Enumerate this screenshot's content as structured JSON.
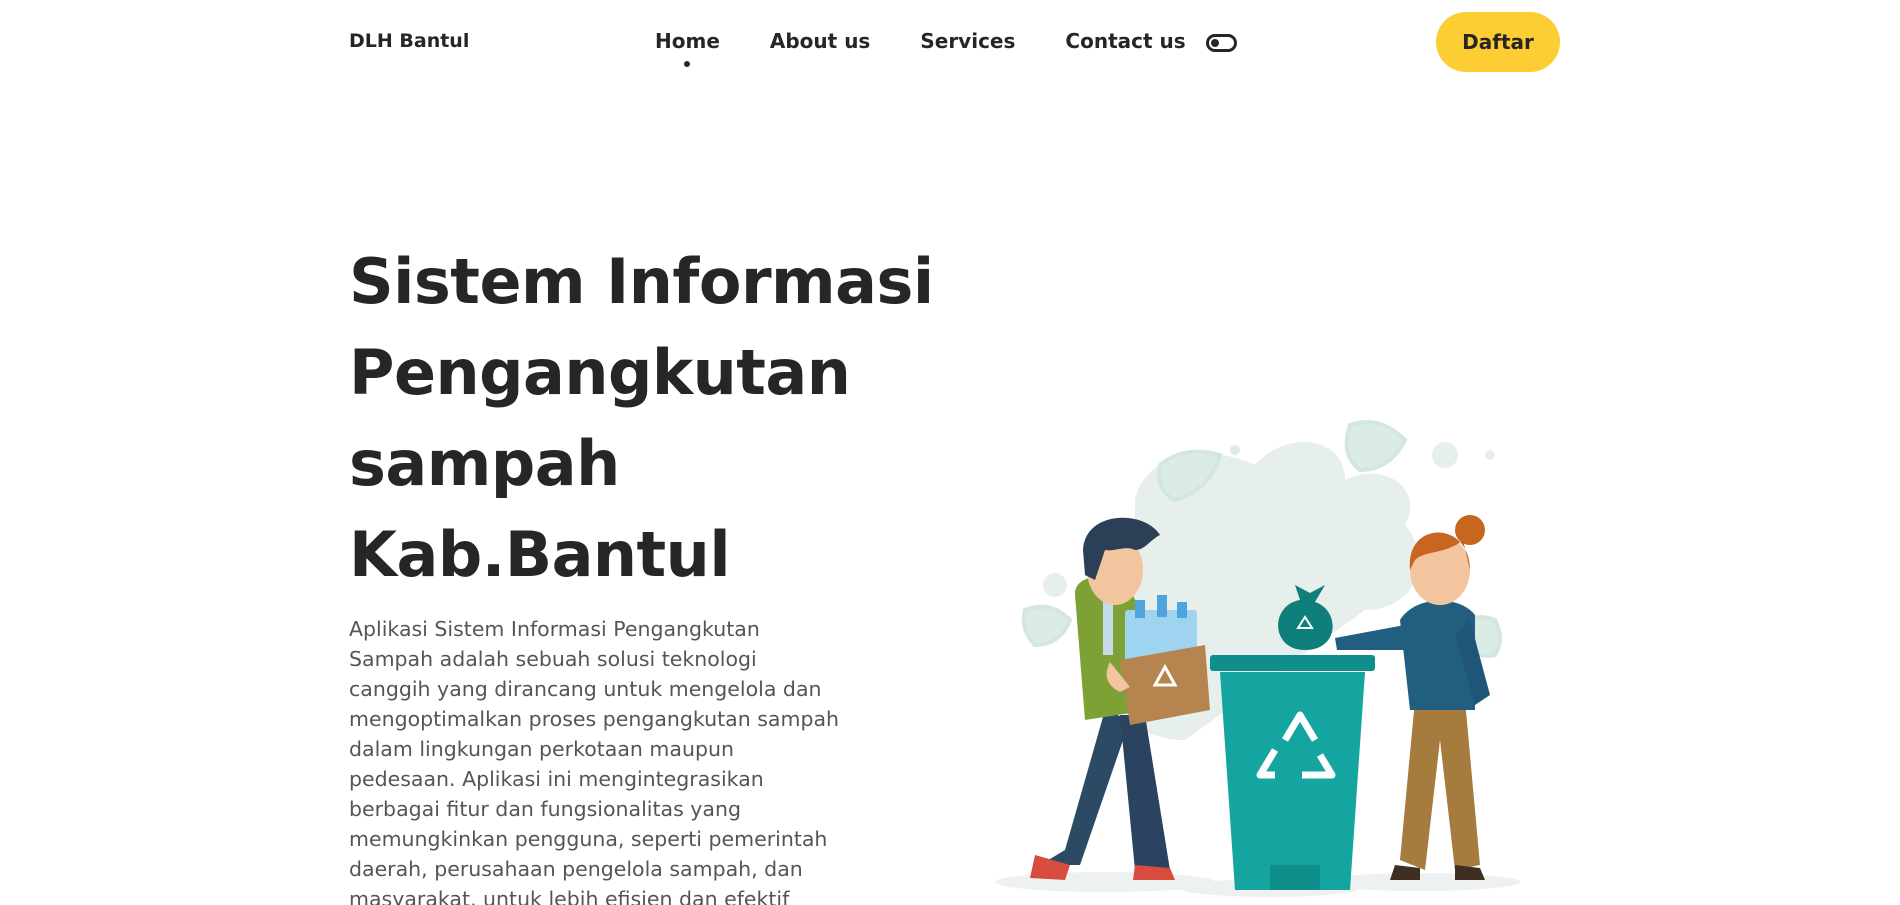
{
  "nav": {
    "brand": "DLH Bantul",
    "items": [
      {
        "label": "Home",
        "active": true
      },
      {
        "label": "About us",
        "active": false
      },
      {
        "label": "Services",
        "active": false
      },
      {
        "label": "Contact us",
        "active": false
      }
    ],
    "theme_toggle_icon": "toggle-icon",
    "cta_label": "Daftar"
  },
  "hero": {
    "title_lines": [
      "Sistem Informasi",
      "Pengangkutan",
      "sampah",
      "Kab.Bantul"
    ],
    "description_lines": [
      "Aplikasi Sistem Informasi Pengangkutan",
      "Sampah adalah sebuah solusi teknologi",
      "canggih yang dirancang untuk mengelola dan",
      "mengoptimalkan proses pengangkutan sampah",
      "dalam lingkungan perkotaan maupun",
      "pedesaan. Aplikasi ini mengintegrasikan",
      "berbagai fitur dan fungsionalitas yang",
      "memungkinkan pengguna, seperti pemerintah",
      "daerah, perusahaan pengelola sampah, dan",
      "masyarakat, untuk lebih efisien dan efektif"
    ]
  },
  "colors": {
    "accent": "#fdce34",
    "text": "#262626",
    "muted_text": "#555555",
    "bin_teal": "#15a5a0"
  }
}
